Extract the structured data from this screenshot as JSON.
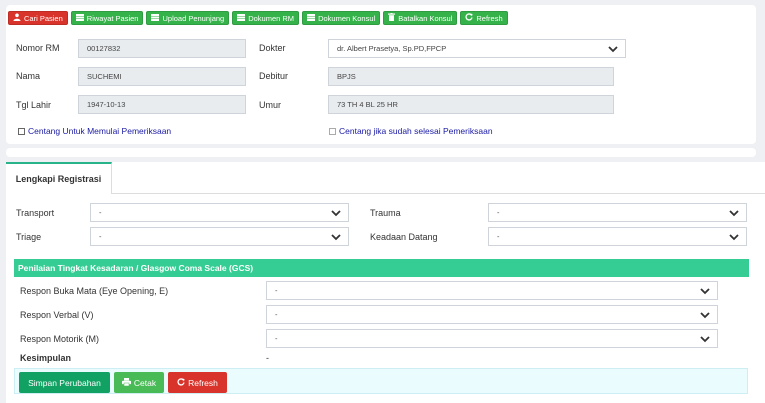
{
  "toolbar": {
    "buttons": [
      {
        "label": "Cari Pasien",
        "icon": "user-icon",
        "color": "#d9342b"
      },
      {
        "label": "Riwayat Pasien",
        "icon": "list-icon",
        "color": "#36b24a"
      },
      {
        "label": "Upload Penunjang",
        "icon": "list-icon",
        "color": "#36b24a"
      },
      {
        "label": "Dokumen RM",
        "icon": "list-icon",
        "color": "#36b24a"
      },
      {
        "label": "Dokumen Konsul",
        "icon": "list-icon",
        "color": "#36b24a"
      },
      {
        "label": "Batalkan Konsul",
        "icon": "trash-icon",
        "color": "#36b24a"
      },
      {
        "label": "Refresh",
        "icon": "refresh-icon",
        "color": "#36b24a"
      }
    ]
  },
  "patient": {
    "nomor_rm_label": "Nomor RM",
    "nomor_rm": "00127832",
    "nama_label": "Nama",
    "nama": "SUCHEMI",
    "tgl_lahir_label": "Tgl Lahir",
    "tgl_lahir": "1947-10-13",
    "dokter_label": "Dokter",
    "dokter": "dr. Albert Prasetya, Sp.PD,FPCP",
    "debitur_label": "Debitur",
    "debitur": "BPJS",
    "umur_label": "Umur",
    "umur": "73 TH 4 BL 25 HR"
  },
  "checks": {
    "start": "Centang Untuk Memulai Pemeriksaan",
    "finish": "Centang jika sudah selesai Pemeriksaan"
  },
  "registration": {
    "tab_label": "Lengkapi Registrasi",
    "transport_label": "Transport",
    "transport_value": "-",
    "triage_label": "Triage",
    "triage_value": "-",
    "trauma_label": "Trauma",
    "trauma_value": "-",
    "keadaan_label": "Keadaan Datang",
    "keadaan_value": "-"
  },
  "gcs": {
    "header": "Penilaian Tingkat Kesadaran / Glasgow Coma Scale (GCS)",
    "eye_label": "Respon Buka Mata (Eye Opening, E)",
    "eye_value": "-",
    "verbal_label": "Respon Verbal (V)",
    "verbal_value": "-",
    "motor_label": "Respon Motorik (M)",
    "motor_value": "-",
    "kesimpulan_label": "Kesimpulan",
    "kesimpulan_value": "-"
  },
  "actions": {
    "save": "Simpan Perubahan",
    "print": "Cetak",
    "refresh": "Refresh"
  },
  "colors": {
    "accent_green": "#35cd93",
    "tab_border": "#29b38b",
    "danger": "#d9342b",
    "success": "#36b24a",
    "save_button": "#11a163"
  }
}
